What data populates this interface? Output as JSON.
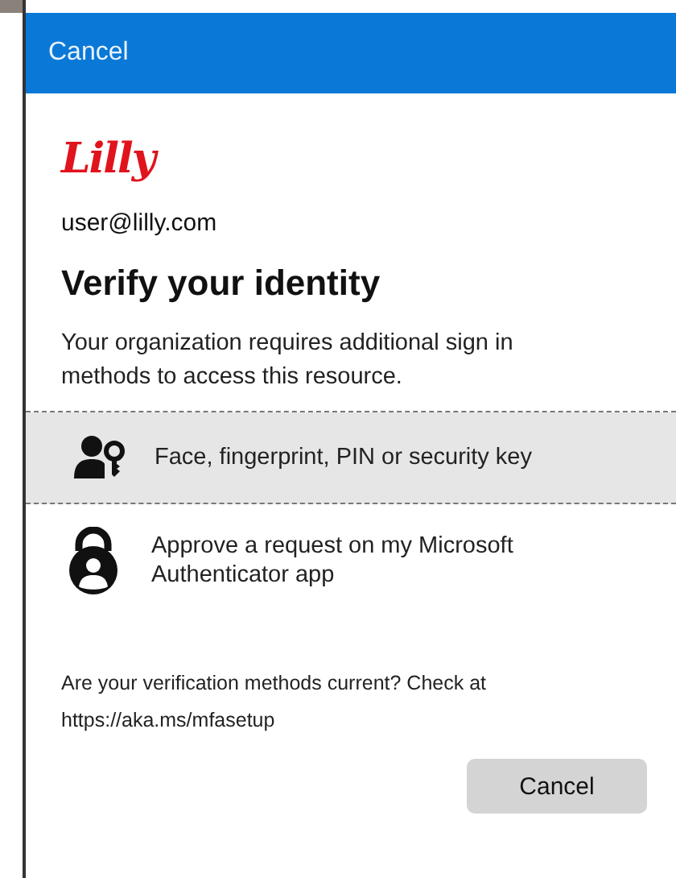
{
  "header": {
    "cancel": "Cancel"
  },
  "logo": "Lilly",
  "account": "user@lilly.com",
  "title": "Verify your identity",
  "description": "Your organization requires additional sign in methods to access this resource.",
  "methods": [
    {
      "kind": "person-key",
      "label": "Face, fingerprint, PIN or security key",
      "selected": true
    },
    {
      "kind": "authenticator",
      "label": "Approve a request on my Microsoft Authenticator app",
      "selected": false
    }
  ],
  "footer_text": "Are your verification methods current? Check at https://aka.ms/mfasetup",
  "button": "Cancel"
}
